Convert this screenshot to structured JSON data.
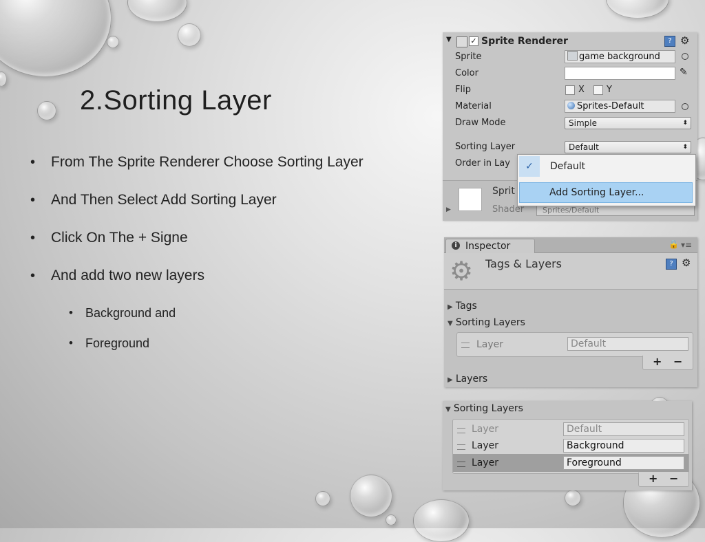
{
  "slide": {
    "title": "2.Sorting Layer",
    "bullets": [
      "From The Sprite Renderer Choose Sorting Layer",
      "And Then Select Add Sorting Layer",
      "Click On The + Signe",
      "And add two new layers"
    ],
    "sub_bullets": [
      "Background and",
      "Foreground"
    ]
  },
  "sprite_renderer": {
    "header": "Sprite Renderer",
    "labels": {
      "sprite": "Sprite",
      "color": "Color",
      "flip": "Flip",
      "material": "Material",
      "draw_mode": "Draw Mode",
      "sorting_layer": "Sorting Layer",
      "order_in_layer": "Order in Lay"
    },
    "sprite_value": "game background",
    "flip_x": "X",
    "flip_y": "Y",
    "material_value": "Sprites-Default",
    "draw_mode_value": "Simple",
    "sorting_layer_value": "Default",
    "menu": {
      "items": [
        "Default",
        "Add Sorting Layer..."
      ],
      "checked": "✓"
    },
    "bottom": {
      "sprite_label": "Sprit",
      "shader_label": "Shader",
      "shader_value": "Sprites/Default"
    }
  },
  "inspector": {
    "tab": "Inspector",
    "header": "Tags & Layers",
    "sections": [
      "Tags",
      "Sorting Layers",
      "Layers"
    ],
    "row": {
      "label": "Layer",
      "value": "Default"
    },
    "plus": "+",
    "minus": "−"
  },
  "sorting_layers": {
    "header": "Sorting Layers",
    "rows": [
      {
        "label": "Layer",
        "value": "Default"
      },
      {
        "label": "Layer",
        "value": "Background"
      },
      {
        "label": "Layer",
        "value": "Foreground"
      }
    ],
    "plus": "+",
    "minus": "−"
  }
}
